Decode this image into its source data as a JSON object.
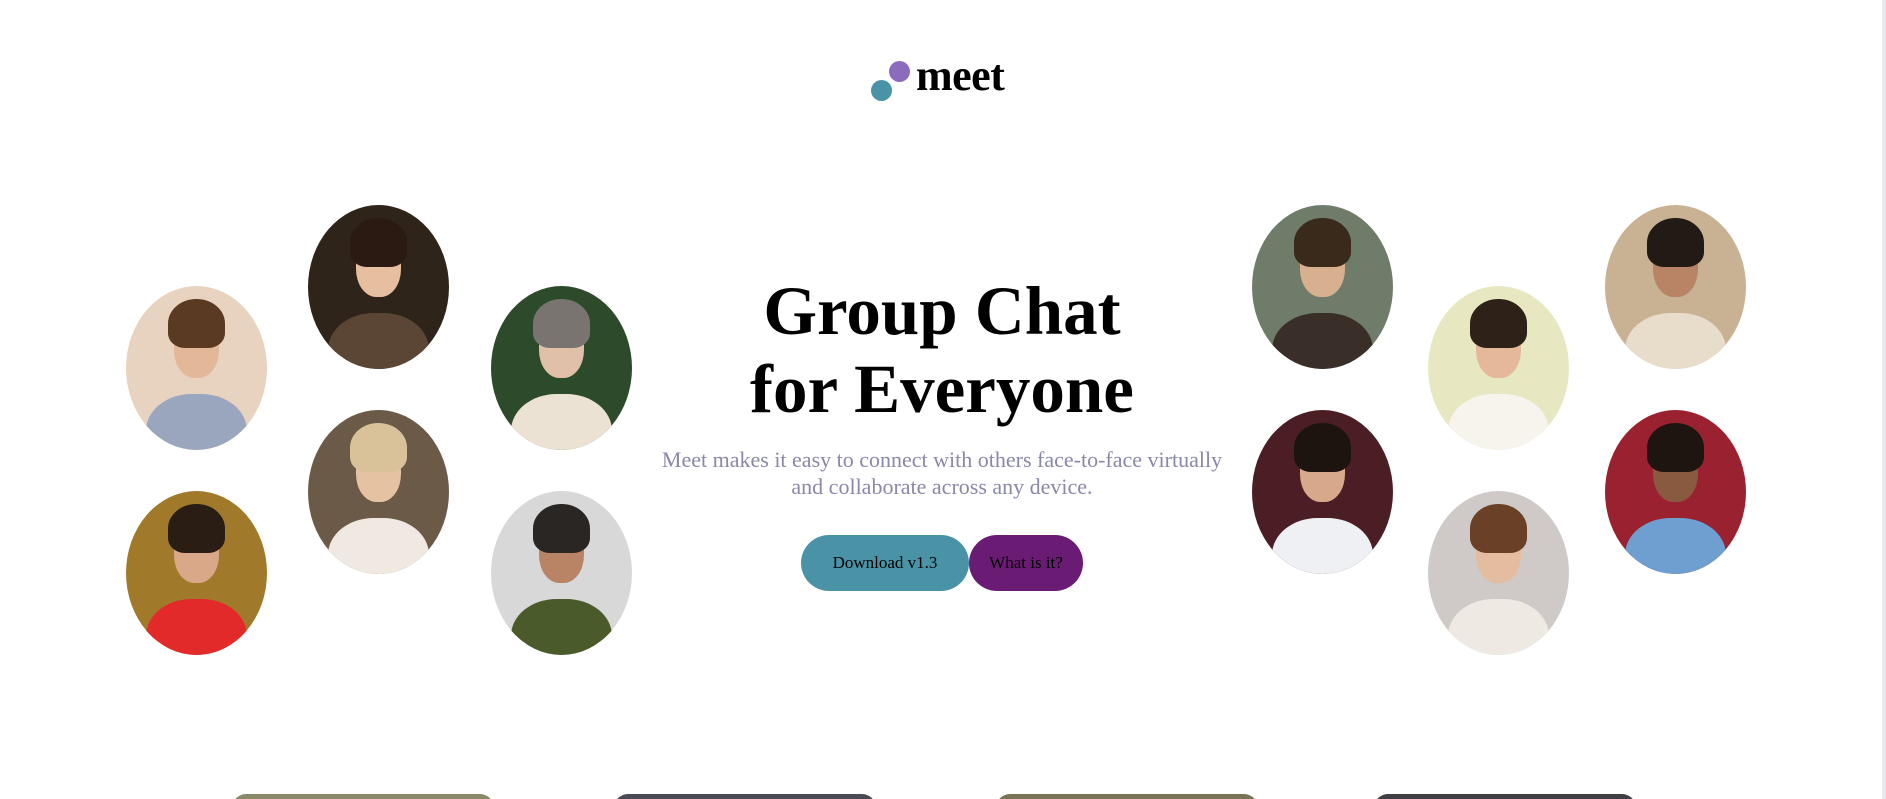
{
  "brand": {
    "name": "meet",
    "colors": {
      "teal": "#4a93a6",
      "purple": "#8c6bbf",
      "dark_purple": "#6a1b74",
      "subtitle": "#8a88a8"
    }
  },
  "hero": {
    "title_line1": "Group Chat",
    "title_line2": "for Everyone",
    "subtitle_line1": "Meet makes it easy to connect with others face-to-face virtually",
    "subtitle_line2": "and collaborate across any device."
  },
  "buttons": {
    "download_label": "Download v1.3",
    "what_label": "What is it?"
  },
  "avatars_left": [
    {
      "id": "young-man-sunset",
      "bg": "#e8d3c0",
      "skin": "#e2b898",
      "hair": "#5a3a22",
      "cloth": "#9aa6bd"
    },
    {
      "id": "woman-smiling-dark-hair",
      "bg": "#2e2419",
      "skin": "#e6bfa1",
      "hair": "#2b1a12",
      "cloth": "#5b4636"
    },
    {
      "id": "woman-blonde-smiling",
      "bg": "#6b5a48",
      "skin": "#e5c2a2",
      "hair": "#d9c29a",
      "cloth": "#efe9e1"
    },
    {
      "id": "man-bearded-fur-hat",
      "bg": "#a07a2a",
      "skin": "#d8a888",
      "hair": "#2a1d14",
      "cloth": "#e32a2a"
    },
    {
      "id": "man-glasses-shearling",
      "bg": "#2d4a2a",
      "skin": "#e0c0a8",
      "hair": "#7a7470",
      "cloth": "#ece2d4"
    },
    {
      "id": "older-man-grey-beard",
      "bg": "#d8d8d8",
      "skin": "#b98466",
      "hair": "#2a2624",
      "cloth": "#4a5a2a"
    }
  ],
  "avatars_right": [
    {
      "id": "man-sunglasses",
      "bg": "#6f7c6a",
      "skin": "#d7b08f",
      "hair": "#3a2a1c",
      "cloth": "#3a2e28"
    },
    {
      "id": "man-dark-hair-blossoms",
      "bg": "#4a1e24",
      "skin": "#d8a88a",
      "hair": "#1d1410",
      "cloth": "#eef0f4"
    },
    {
      "id": "man-laughing-yellow-bg",
      "bg": "#e7e8c2",
      "skin": "#e4b898",
      "hair": "#2e2218",
      "cloth": "#f7f4ee"
    },
    {
      "id": "man-curly-hair",
      "bg": "#cfcac7",
      "skin": "#e4bca0",
      "hair": "#6a4126",
      "cloth": "#efe9e4"
    },
    {
      "id": "couple-flowers",
      "bg": "#c9b294",
      "skin": "#b98466",
      "hair": "#221a14",
      "cloth": "#e8dccb"
    },
    {
      "id": "woman-denim-red-wall",
      "bg": "#9a2230",
      "skin": "#8a5a40",
      "hair": "#1e1510",
      "cloth": "#6e9fd0"
    }
  ]
}
